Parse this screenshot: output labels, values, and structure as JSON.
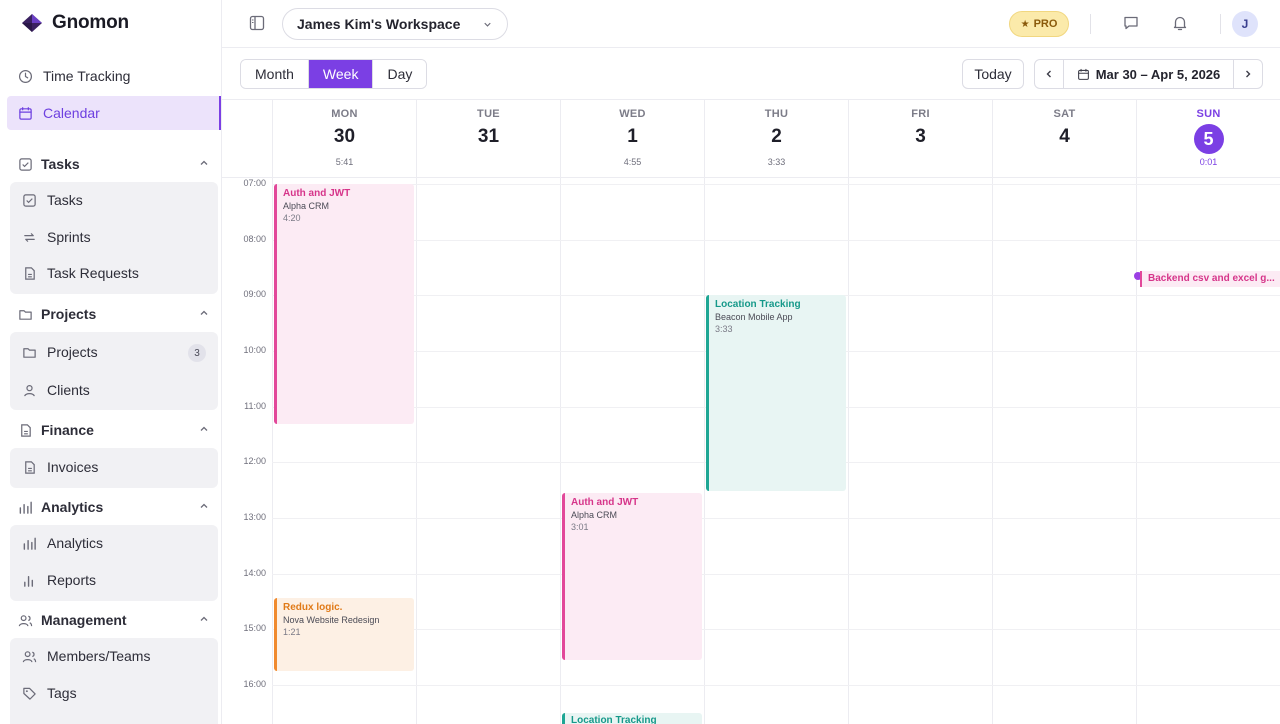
{
  "app": {
    "name": "Gnomon"
  },
  "sidebar": {
    "top_items": [
      {
        "label": "Time Tracking",
        "icon": "clock-icon"
      },
      {
        "label": "Calendar",
        "icon": "calendar-icon",
        "active": true
      }
    ],
    "groups": [
      {
        "label": "Tasks",
        "items": [
          {
            "label": "Tasks"
          },
          {
            "label": "Sprints"
          },
          {
            "label": "Task Requests"
          }
        ]
      },
      {
        "label": "Projects",
        "items": [
          {
            "label": "Projects",
            "count": "3"
          },
          {
            "label": "Clients"
          }
        ]
      },
      {
        "label": "Finance",
        "items": [
          {
            "label": "Invoices"
          }
        ]
      },
      {
        "label": "Analytics",
        "items": [
          {
            "label": "Analytics"
          },
          {
            "label": "Reports"
          }
        ]
      },
      {
        "label": "Management",
        "items": [
          {
            "label": "Members/Teams"
          },
          {
            "label": "Tags"
          }
        ]
      }
    ]
  },
  "header": {
    "workspace": "James Kim's Workspace",
    "pro_label": "PRO",
    "avatar_initial": "J"
  },
  "toolbar": {
    "views": [
      "Month",
      "Week",
      "Day"
    ],
    "active_view": "Week",
    "today_label": "Today",
    "range_label": "Mar 30 – Apr 5, 2026"
  },
  "calendar": {
    "days": [
      {
        "name": "MON",
        "num": "30",
        "duration": "5:41"
      },
      {
        "name": "TUE",
        "num": "31",
        "duration": ""
      },
      {
        "name": "WED",
        "num": "1",
        "duration": "4:55"
      },
      {
        "name": "THU",
        "num": "2",
        "duration": "3:33"
      },
      {
        "name": "FRI",
        "num": "3",
        "duration": ""
      },
      {
        "name": "SAT",
        "num": "4",
        "duration": ""
      },
      {
        "name": "SUN",
        "num": "5",
        "duration": "0:01",
        "today": true
      }
    ],
    "hours": [
      "07:00",
      "08:00",
      "09:00",
      "10:00",
      "11:00",
      "12:00",
      "13:00",
      "14:00",
      "15:00",
      "16:00"
    ],
    "events": [
      {
        "title": "Auth and JWT",
        "project": "Alpha CRM",
        "duration": "4:20",
        "color": "pink"
      },
      {
        "title": "Redux logic.",
        "project": "Nova Website Redesign",
        "duration": "1:21",
        "color": "orange"
      },
      {
        "title": "Auth and JWT",
        "project": "Alpha CRM",
        "duration": "3:01",
        "color": "pink"
      },
      {
        "title": "Location Tracking",
        "project": "",
        "duration": "",
        "color": "teal"
      },
      {
        "title": "Location Tracking",
        "project": "Beacon Mobile App",
        "duration": "3:33",
        "color": "teal"
      }
    ],
    "running": {
      "title": "Backend csv and excel g..."
    }
  },
  "colors": {
    "accent": "#7b3fe4",
    "pink": "#e2489a",
    "teal": "#1ea694",
    "orange": "#f08a2e"
  }
}
